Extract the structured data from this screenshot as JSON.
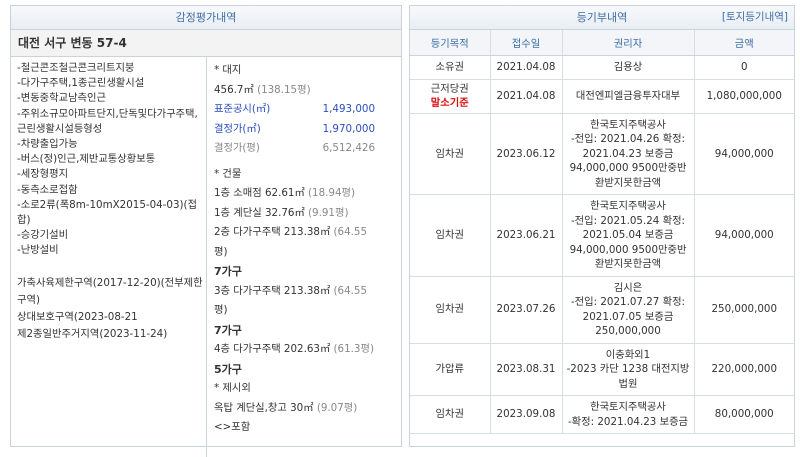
{
  "appraisal": {
    "title": "감정평가내역",
    "address": "대전 서구 변동 57-4",
    "features": "-철근콘조철근콘크리트지붕\n-다가구주택,1종근린생활시설\n-변동중학교남측인근\n-주위소규모아파트단지,단독및다가구주택,근린생활시설등형성\n-차량출입가능\n-버스(정)인근,제반교통상황보통\n-세장형평지\n-동측소로접함\n-소로2류(폭8m-10mX2015-04-03)(접합)\n-승강기설비\n-난방설비",
    "zones": [
      "가축사육제한구역(2017-12-20)(전부제한구역)",
      "상대보호구역(2023-08-21",
      "제2종일반주거지역(2023-11-24)"
    ],
    "land_header": "* 대지",
    "land_area": "456.7㎡",
    "land_area_pyeong": "(138.15평)",
    "official_price_label": "표준공시(㎡)",
    "official_price": "1,493,000",
    "decided_price_label": "결정가(㎡)",
    "decided_price": "1,970,000",
    "decided_total_label": "결정가(평)",
    "decided_total": "6,512,426",
    "building_header": "* 건물",
    "floors": [
      {
        "text": "1층  소매점  62.61㎡",
        "pyeong": "(18.94평)"
      },
      {
        "text": "1층  계단실  32.76㎡",
        "pyeong": "(9.91평)"
      },
      {
        "text": "2층  다가구주택  213.38㎡",
        "pyeong": "(64.55"
      },
      {
        "text": "평)",
        "pyeong": ""
      },
      {
        "text": "7가구",
        "pyeong": "",
        "bold": true
      },
      {
        "text": "3층  다가구주택  213.38㎡",
        "pyeong": "(64.55"
      },
      {
        "text": "평)",
        "pyeong": ""
      },
      {
        "text": "7가구",
        "pyeong": "",
        "bold": true
      },
      {
        "text": "4층  다가구주택  202.63㎡",
        "pyeong": "(61.3평)"
      },
      {
        "text": "5가구",
        "pyeong": "",
        "bold": true
      }
    ],
    "extra_header": "* 제시외",
    "extra_line": "옥탑  계단실,창고  30㎡",
    "extra_pyeong": "(9.07평)",
    "extra_note": "<>포함"
  },
  "registry": {
    "title": "등기부내역",
    "land_link": "[토지등기내역]",
    "columns": [
      "등기목적",
      "접수일",
      "권리자",
      "금액"
    ],
    "rows": [
      {
        "purpose": "소유권",
        "date": "2021.04.08",
        "holder": "김용상",
        "amount": "0"
      },
      {
        "purpose": "근저당권",
        "purpose_note": "말소기준",
        "date": "2021.04.08",
        "holder": "대전엔피엘금융투자대부",
        "amount": "1,080,000,000"
      },
      {
        "purpose": "임차권",
        "date": "2023.06.12",
        "holder": "한국토지주택공사\n-전입: 2021.04.26 확정: 2021.04.23 보증금 94,000,000 9500만중반환받지못한금액",
        "amount": "94,000,000"
      },
      {
        "purpose": "임차권",
        "date": "2023.06.21",
        "holder": "한국토지주택공사\n-전입: 2021.05.24 확정: 2021.05.04 보증금 94,000,000 9500만중반환받지못한금액",
        "amount": "94,000,000"
      },
      {
        "purpose": "임차권",
        "date": "2023.07.26",
        "holder": "김시은\n-전입: 2021.07.27 확정: 2021.07.05 보증금 250,000,000",
        "amount": "250,000,000"
      },
      {
        "purpose": "가압류",
        "date": "2023.08.31",
        "holder": "이충화외1\n-2023 카단 1238 대전지방법원",
        "amount": "220,000,000"
      },
      {
        "purpose": "임차권",
        "date": "2023.09.08",
        "holder": "한국토지주택공사\n-확정: 2021.04.23 보증금",
        "amount": "80,000,000"
      }
    ]
  }
}
